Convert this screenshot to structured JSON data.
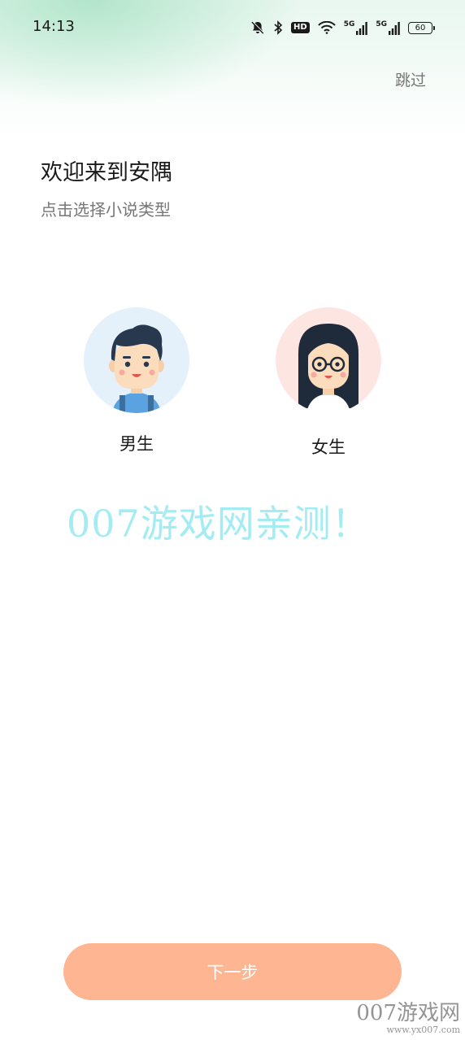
{
  "status_bar": {
    "time": "14:13",
    "hd_label": "HD",
    "network_1": "5G",
    "network_2": "5G",
    "battery": "60",
    "icons": [
      "mute-bell-icon",
      "bluetooth-icon",
      "hd-icon",
      "wifi-icon",
      "signal-icon",
      "signal-icon",
      "battery-icon"
    ]
  },
  "skip_label": "跳过",
  "welcome": {
    "title": "欢迎来到安隅",
    "subtitle": "点击选择小说类型"
  },
  "genders": {
    "male": {
      "label": "男生"
    },
    "female": {
      "label": "女生"
    }
  },
  "watermark": "007游戏网亲测！",
  "next_button": "下一步",
  "corner_watermark": {
    "brand": "007游戏网",
    "url": "www.yx007.com"
  },
  "colors": {
    "accent": "#fdb592",
    "male_avatar_bg": "#e4f1fb",
    "female_avatar_bg": "#fde5e2",
    "watermark": "#a4ecf4"
  }
}
